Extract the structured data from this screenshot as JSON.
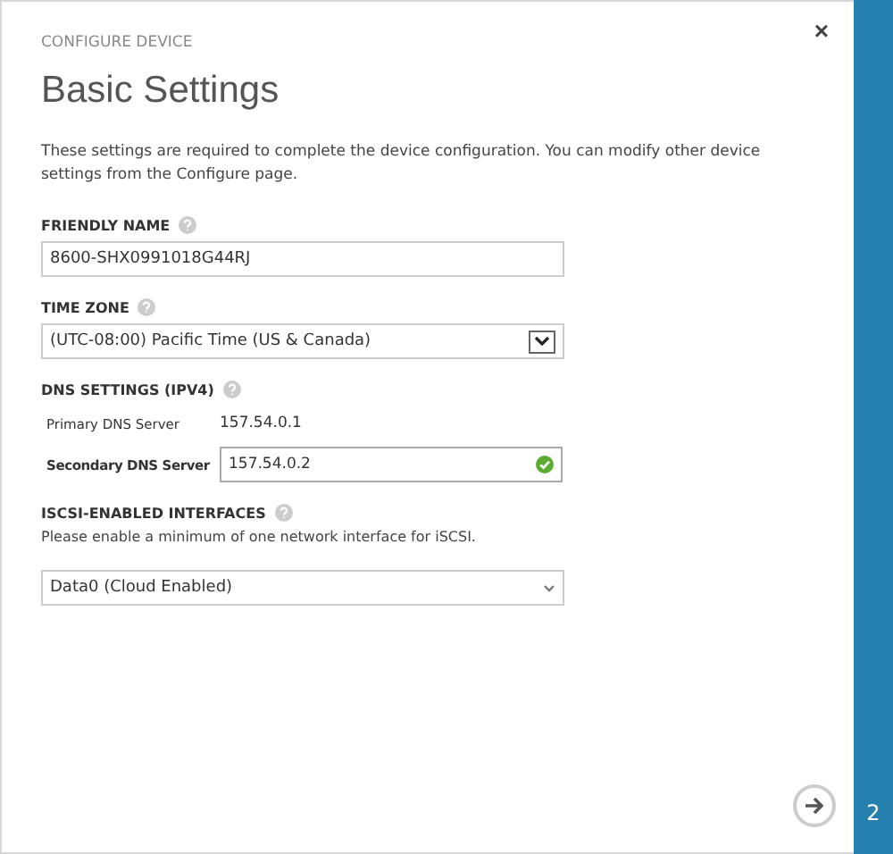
{
  "dialog": {
    "overline": "CONFIGURE DEVICE",
    "title": "Basic Settings",
    "close": "×",
    "intro": "These settings are required to complete the device configuration. You can modify other device settings from the Configure page."
  },
  "friendly_name": {
    "label": "FRIENDLY NAME",
    "value": "8600-SHX0991018G44RJ"
  },
  "time_zone": {
    "label": "TIME ZONE",
    "value": "(UTC-08:00) Pacific Time (US & Canada)"
  },
  "dns": {
    "label": "DNS SETTINGS (IPV4)",
    "primary_label": "Primary DNS Server",
    "primary_value": "157.54.0.1",
    "secondary_label": "Secondary DNS Server",
    "secondary_value": "157.54.0.2",
    "secondary_valid": true
  },
  "iscsi": {
    "label": "ISCSI-ENABLED INTERFACES",
    "hint": "Please enable a minimum of one network interface for iSCSI.",
    "value": "Data0 (Cloud Enabled)"
  },
  "step": {
    "number": "2"
  }
}
